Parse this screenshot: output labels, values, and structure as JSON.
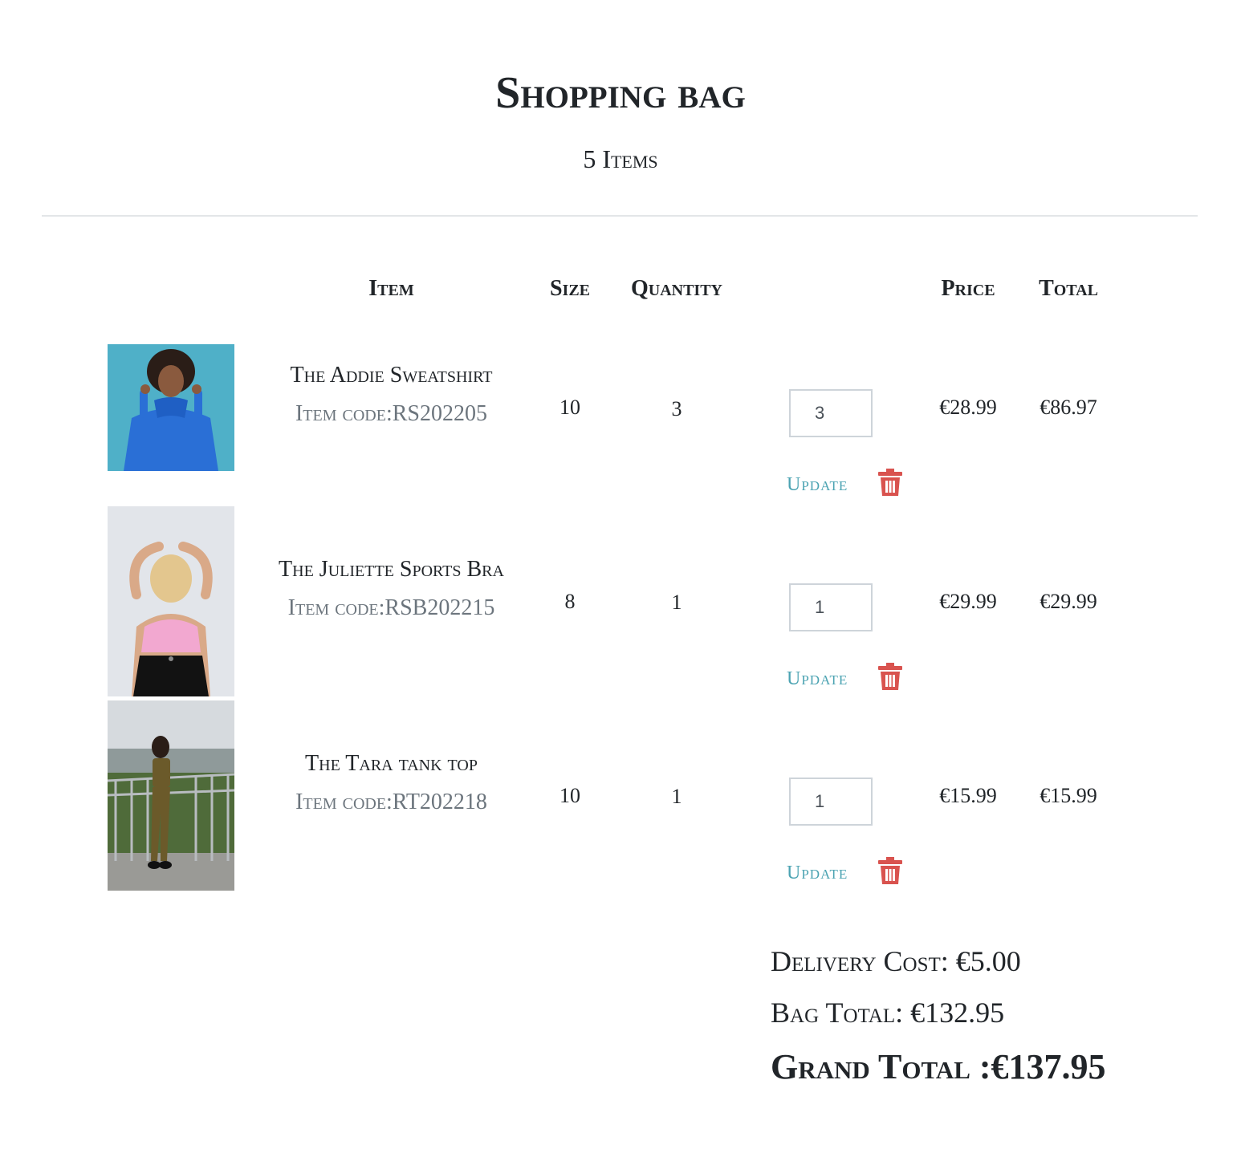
{
  "header": {
    "title": "Shopping bag",
    "item_count": "5 Items"
  },
  "table": {
    "columns": {
      "item": "Item",
      "size": "Size",
      "quantity": "Quantity",
      "price": "Price",
      "total": "Total"
    },
    "rows": [
      {
        "name": "The Addie Sweatshirt",
        "code": "Item code:RS202205",
        "size": "10",
        "quantity": "3",
        "input_value": "3",
        "price": "€28.99",
        "total": "€86.97",
        "update_label": "Update",
        "delete_icon": "trash-icon"
      },
      {
        "name": "The Juliette Sports Bra",
        "code": "Item code:RSB202215",
        "size": "8",
        "quantity": "1",
        "input_value": "1",
        "price": "€29.99",
        "total": "€29.99",
        "update_label": "Update",
        "delete_icon": "trash-icon"
      },
      {
        "name": "The Tara tank top",
        "code": "Item code:RT202218",
        "size": "10",
        "quantity": "1",
        "input_value": "1",
        "price": "€15.99",
        "total": "€15.99",
        "update_label": "Update",
        "delete_icon": "trash-icon"
      }
    ]
  },
  "summary": {
    "delivery": "Delivery Cost: €5.00",
    "bag_total": "Bag Total: €132.95",
    "grand_total": "Grand Total :€137.95"
  },
  "colors": {
    "link": "#4ba3b2",
    "delete": "#d9534f",
    "text": "#212529",
    "muted": "#6c757d"
  }
}
